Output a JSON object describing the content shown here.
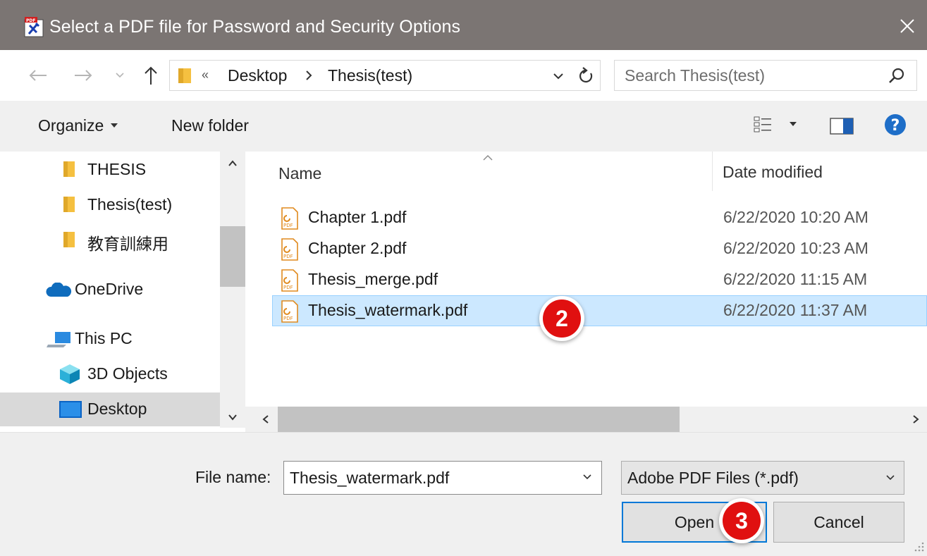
{
  "window": {
    "title": "Select a PDF file for Password and Security Options"
  },
  "nav": {
    "breadcrumb_overflow": "«",
    "breadcrumb": [
      "Desktop",
      "Thesis(test)"
    ],
    "search_placeholder": "Search Thesis(test)"
  },
  "commands": {
    "organize": "Organize",
    "new_folder": "New folder"
  },
  "sidebar": {
    "items": [
      {
        "label": "THESIS",
        "icon": "folder-icon"
      },
      {
        "label": "Thesis(test)",
        "icon": "folder-icon"
      },
      {
        "label": "教育訓練用",
        "icon": "folder-icon"
      },
      {
        "label": "OneDrive",
        "icon": "cloud-icon"
      },
      {
        "label": "This PC",
        "icon": "computer-icon"
      },
      {
        "label": "3D Objects",
        "icon": "cube-icon"
      },
      {
        "label": "Desktop",
        "icon": "desktop-icon",
        "selected": true
      }
    ]
  },
  "filelist": {
    "columns": [
      "Name",
      "Date modified"
    ],
    "files": [
      {
        "name": "Chapter 1.pdf",
        "date": "6/22/2020 10:20 AM"
      },
      {
        "name": "Chapter 2.pdf",
        "date": "6/22/2020 10:23 AM"
      },
      {
        "name": "Thesis_merge.pdf",
        "date": "6/22/2020 11:15 AM"
      },
      {
        "name": "Thesis_watermark.pdf",
        "date": "6/22/2020 11:37 AM",
        "selected": true
      }
    ]
  },
  "bottom": {
    "file_name_label": "File name:",
    "file_name_value": "Thesis_watermark.pdf",
    "file_type": "Adobe PDF Files (*.pdf)",
    "open_label": "Open",
    "cancel_label": "Cancel"
  },
  "annotations": {
    "step_select": "2",
    "step_open": "3"
  },
  "colors": {
    "titlebar": "#7b7573",
    "selection": "#cce8ff",
    "selection_border": "#99d1ff",
    "badge": "#e01010",
    "accent": "#0078d7"
  }
}
